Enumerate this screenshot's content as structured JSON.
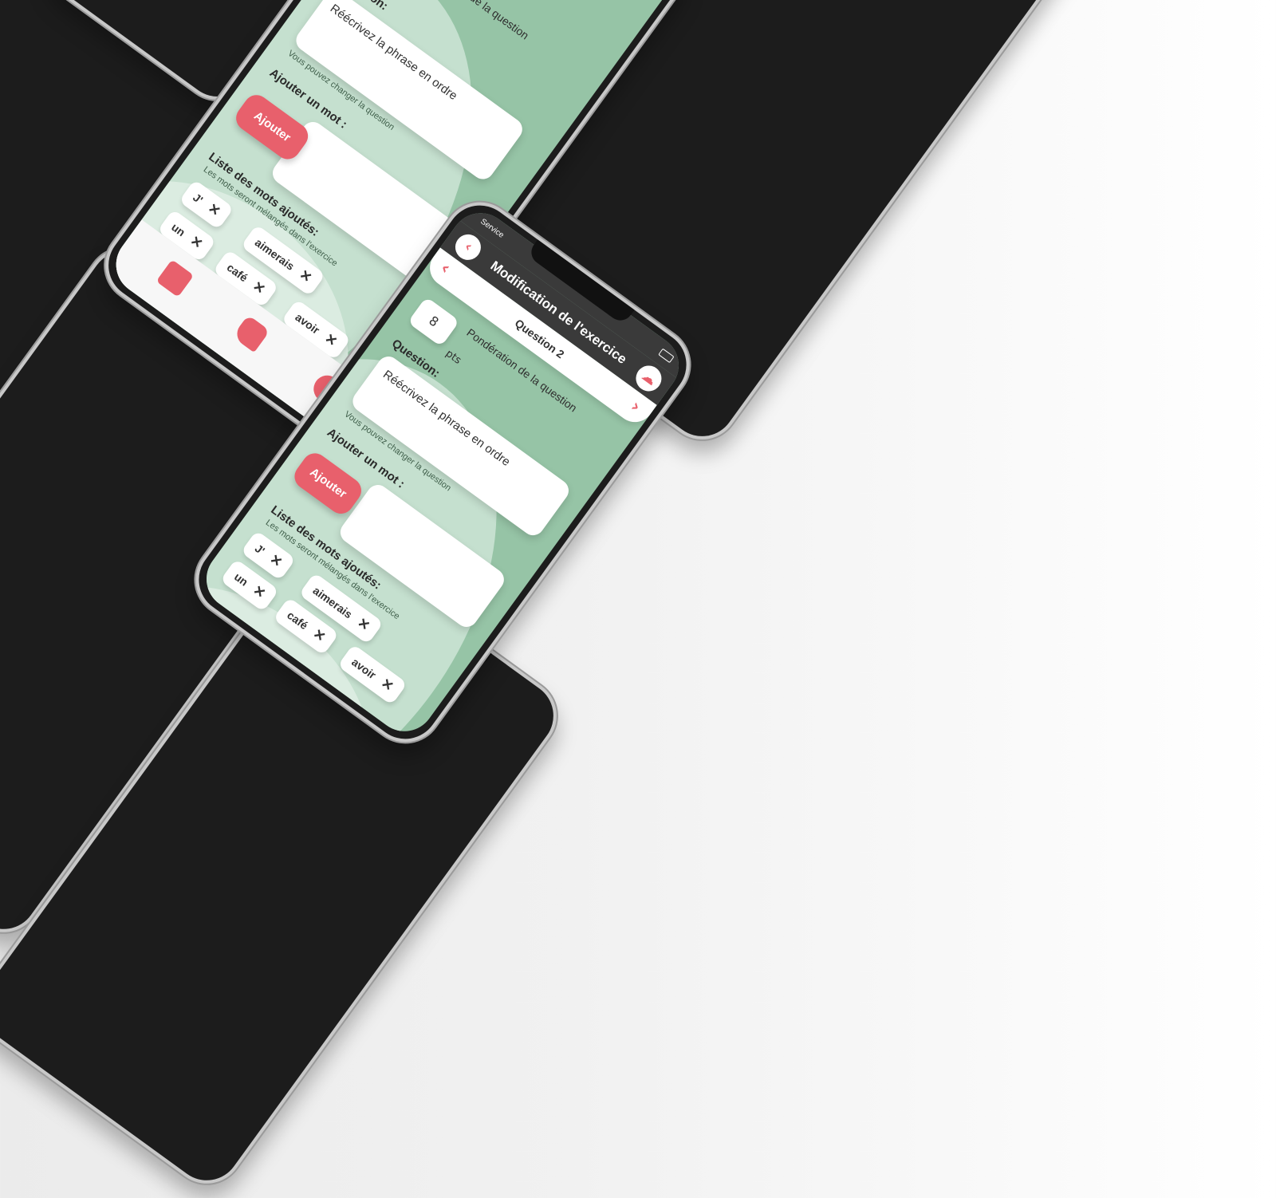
{
  "device": {
    "status": {
      "carrier": "Service"
    },
    "header": {
      "title": "Modification de l'exercice",
      "back_icon": "chevron-left-icon",
      "cloud_icon": "cloud-save-icon"
    },
    "question_nav": {
      "label": "Question 2",
      "prev_icon": "chevron-left-icon",
      "next_icon": "chevron-right-icon"
    },
    "ponderation": {
      "value": "8",
      "label": "Pondération de la question",
      "unit": "pts"
    },
    "question": {
      "label": "Question:",
      "value": "Réécrivez la phrase en ordre",
      "hint": "Vous pouvez changer la question"
    },
    "add_word": {
      "label": "Ajouter un mot :",
      "value": "",
      "button_label": "Ajouter"
    },
    "words_list": {
      "label": "Liste des mots ajoutés:",
      "hint": "Les mots seront mélangés dans l'exercice",
      "words": [
        "J'",
        "aimerais",
        "un",
        "café",
        "avoir"
      ],
      "remove_icon": "close-icon"
    },
    "navbar": {
      "items": [
        "calendar-icon",
        "exercise-icon",
        "profile-icon"
      ]
    }
  },
  "colors": {
    "screen_bg": "#96c4a6",
    "accent": "#e8606c",
    "header": "#3a3a3a"
  }
}
